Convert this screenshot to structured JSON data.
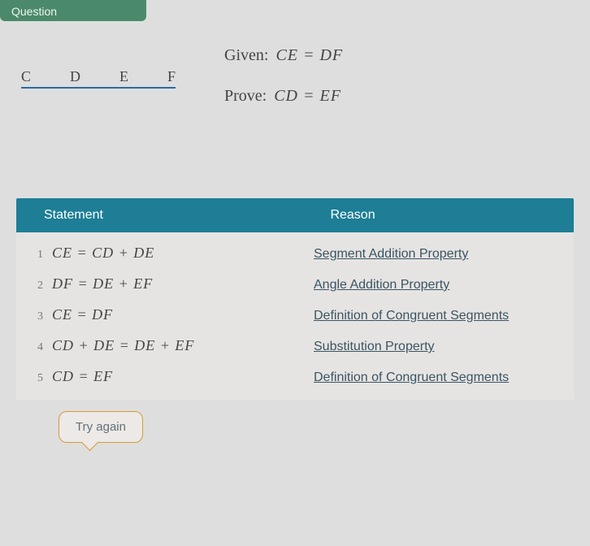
{
  "header": {
    "question_label": "Question"
  },
  "diagram": {
    "points": [
      "C",
      "D",
      "E",
      "F"
    ]
  },
  "given_prove": {
    "given_label": "Given:",
    "given_eq": "CE = DF",
    "prove_label": "Prove:",
    "prove_eq": "CD = EF"
  },
  "table": {
    "head_statement": "Statement",
    "head_reason": "Reason",
    "rows": [
      {
        "n": "1",
        "statement": "CE = CD + DE",
        "reason": "Segment Addition Property"
      },
      {
        "n": "2",
        "statement": "DF = DE + EF",
        "reason": "Angle Addition Property"
      },
      {
        "n": "3",
        "statement": "CE = DF",
        "reason": "Definition of Congruent Segments"
      },
      {
        "n": "4",
        "statement": "CD + DE = DE + EF",
        "reason": "Substitution Property"
      },
      {
        "n": "5",
        "statement": "CD = EF",
        "reason": "Definition of Congruent Segments"
      }
    ]
  },
  "buttons": {
    "try_again": "Try again"
  }
}
